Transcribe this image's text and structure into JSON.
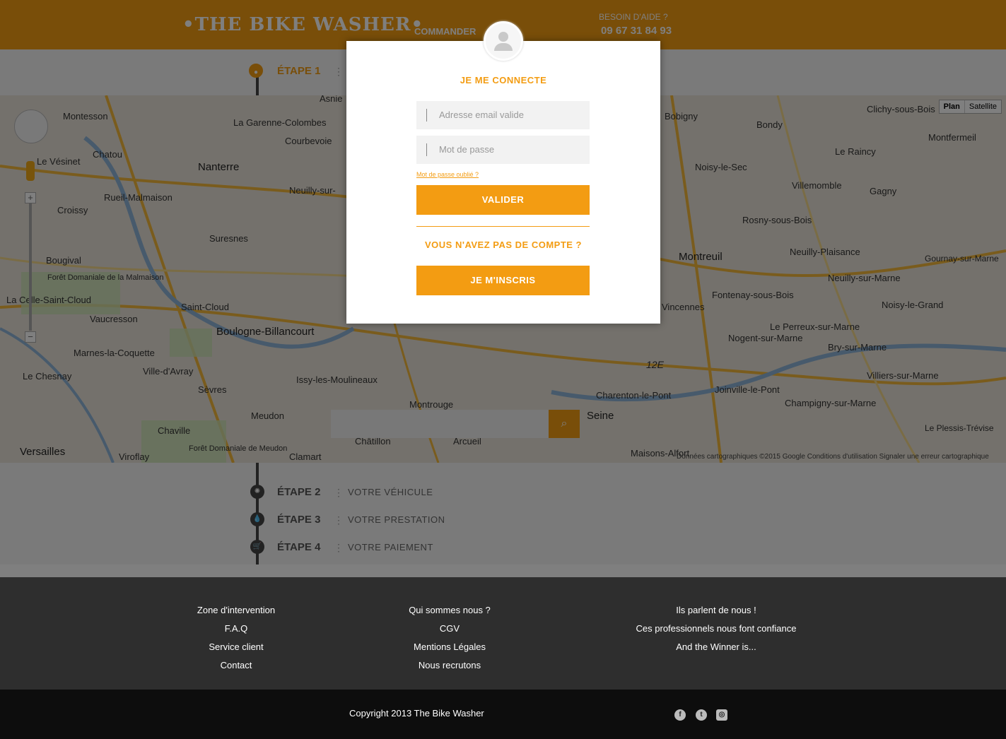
{
  "header": {
    "logo": "•THE BIKE WASHER•",
    "nav_commander": "COMMANDER",
    "help_label": "BESOIN D'AIDE ?",
    "help_phone": "09 67 31 84 93",
    "brand_color": "#f39c12"
  },
  "steps": [
    {
      "label": "ÉTAPE 1",
      "sep": "⋮",
      "desc": "",
      "icon": "map-pin-icon"
    },
    {
      "label": "ÉTAPE 2",
      "sep": "⋮",
      "desc": "VOTRE VÉHICULE",
      "icon": "wheel-icon"
    },
    {
      "label": "ÉTAPE 3",
      "sep": "⋮",
      "desc": "VOTRE PRESTATION",
      "icon": "drop-icon"
    },
    {
      "label": "ÉTAPE 4",
      "sep": "⋮",
      "desc": "VOTRE PAIEMENT",
      "icon": "cart-icon"
    }
  ],
  "map": {
    "type_plan": "Plan",
    "type_satellite": "Satellite",
    "credits": "Données cartographiques ©2015 Google    Conditions d'utilisation    Signaler une erreur cartographique",
    "places": [
      "Montesson",
      "La Garenne-Colombes",
      "Courbevoie",
      "Nanterre",
      "Chatou",
      "Le Vésinet",
      "Rueil-Malmaison",
      "Croissy",
      "Neuilly-sur-",
      "Suresnes",
      "Bougival",
      "Forêt Domaniale de la Malmaison",
      "La Celle-Saint-Cloud",
      "Saint-Cloud",
      "Vaucresson",
      "Boulogne-Billancourt",
      "Marnes-la-Coquette",
      "Ville-d'Avray",
      "Le Chesnay",
      "Sèvres",
      "Issy-les-Moulineaux",
      "Meudon",
      "Chaville",
      "Viroflay",
      "Versailles",
      "Forêt Domaniale de Meudon",
      "Clamart",
      "Châtillon",
      "Arcueil",
      "Montrouge",
      "Bobigny",
      "Bondy",
      "Clichy-sous-Bois",
      "Montfermeil",
      "Le Raincy",
      "Noisy-le-Sec",
      "Villemomble",
      "Gagny",
      "Rosny-sous-Bois",
      "Montreuil",
      "Neuilly-Plaisance",
      "Gournay-sur-Marne",
      "Neuilly-sur-Marne",
      "Fontenay-sous-Bois",
      "Vincennes",
      "Noisy-le-Grand",
      "Le Perreux-sur-Marne",
      "Nogent-sur-Marne",
      "Bry-sur-Marne",
      "Villiers-sur-Marne",
      "Joinville-le-Pont",
      "Charenton-le-Pont",
      "Champigny-sur-Marne",
      "Seine",
      "Maisons-Alfort",
      "Le Plessis-Trévise",
      "12E",
      "Asnie"
    ],
    "search_placeholder": ""
  },
  "modal": {
    "title": "JE ME CONNECTE",
    "email_placeholder": "Adresse email valide",
    "password_placeholder": "Mot de passe",
    "forgot": "Mot de passe oublié ?",
    "submit": "VALIDER",
    "no_account": "VOUS N'AVEZ PAS DE COMPTE ?",
    "signup": "JE M'INSCRIS"
  },
  "footer": {
    "col1": [
      "Zone d'intervention",
      "F.A.Q",
      "Service client",
      "Contact"
    ],
    "col2": [
      "Qui sommes nous ?",
      "CGV",
      "Mentions Légales",
      "Nous recrutons"
    ],
    "col3": [
      "Ils parlent de nous !",
      "Ces professionnels nous font confiance",
      "And the Winner is..."
    ],
    "copyright": "Copyright 2013 The Bike Washer",
    "social": [
      {
        "icon": "facebook-icon",
        "glyph": "f"
      },
      {
        "icon": "twitter-icon",
        "glyph": "t"
      },
      {
        "icon": "instagram-icon",
        "glyph": "◎"
      }
    ]
  }
}
